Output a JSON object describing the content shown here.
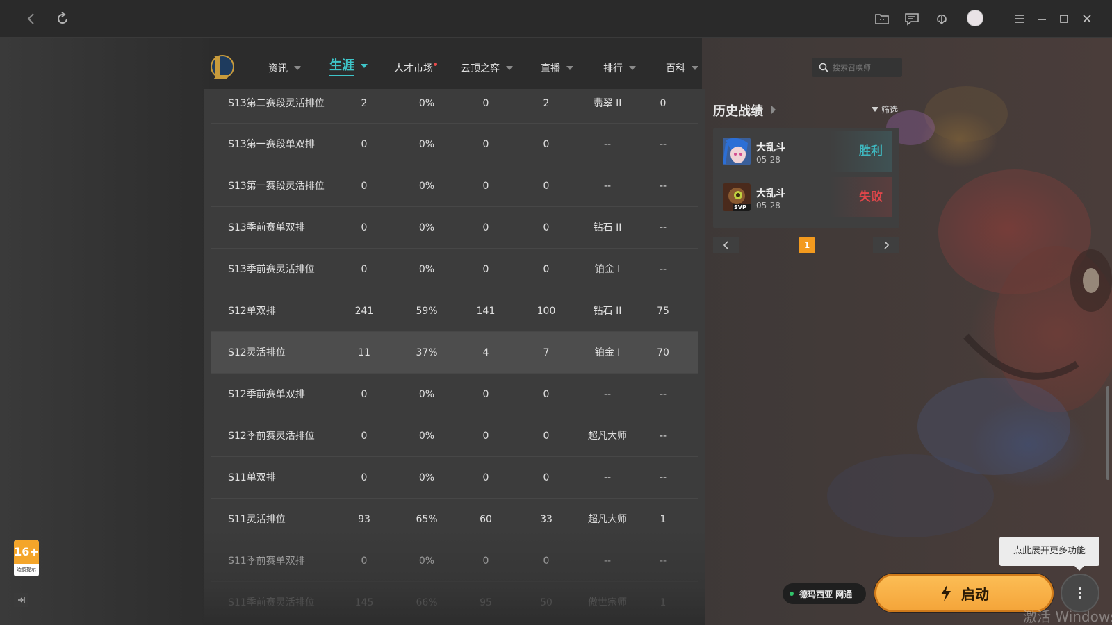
{
  "nav": {
    "items": [
      {
        "label": "资讯"
      },
      {
        "label": "生涯"
      },
      {
        "label": "人才市场"
      },
      {
        "label": "云顶之弈"
      },
      {
        "label": "直播"
      },
      {
        "label": "排行"
      },
      {
        "label": "百科"
      }
    ],
    "search_placeholder": "搜索召唤师"
  },
  "table": {
    "rows": [
      {
        "season": "S13第二赛段灵活排位",
        "games": "2",
        "winrate": "0%",
        "wins": "0",
        "losses": "2",
        "tier": "翡翠 II",
        "lp": "0"
      },
      {
        "season": "S13第一赛段单双排",
        "games": "0",
        "winrate": "0%",
        "wins": "0",
        "losses": "0",
        "tier": "--",
        "lp": "--"
      },
      {
        "season": "S13第一赛段灵活排位",
        "games": "0",
        "winrate": "0%",
        "wins": "0",
        "losses": "0",
        "tier": "--",
        "lp": "--"
      },
      {
        "season": "S13季前赛单双排",
        "games": "0",
        "winrate": "0%",
        "wins": "0",
        "losses": "0",
        "tier": "钻石 II",
        "lp": "--"
      },
      {
        "season": "S13季前赛灵活排位",
        "games": "0",
        "winrate": "0%",
        "wins": "0",
        "losses": "0",
        "tier": "铂金 I",
        "lp": "--"
      },
      {
        "season": "S12单双排",
        "games": "241",
        "winrate": "59%",
        "wins": "141",
        "losses": "100",
        "tier": "钻石 II",
        "lp": "75"
      },
      {
        "season": "S12灵活排位",
        "games": "11",
        "winrate": "37%",
        "wins": "4",
        "losses": "7",
        "tier": "铂金 I",
        "lp": "70"
      },
      {
        "season": "S12季前赛单双排",
        "games": "0",
        "winrate": "0%",
        "wins": "0",
        "losses": "0",
        "tier": "--",
        "lp": "--"
      },
      {
        "season": "S12季前赛灵活排位",
        "games": "0",
        "winrate": "0%",
        "wins": "0",
        "losses": "0",
        "tier": "超凡大师",
        "lp": "--"
      },
      {
        "season": "S11单双排",
        "games": "0",
        "winrate": "0%",
        "wins": "0",
        "losses": "0",
        "tier": "--",
        "lp": "--"
      },
      {
        "season": "S11灵活排位",
        "games": "93",
        "winrate": "65%",
        "wins": "60",
        "losses": "33",
        "tier": "超凡大师",
        "lp": "1"
      },
      {
        "season": "S11季前赛单双排",
        "games": "0",
        "winrate": "0%",
        "wins": "0",
        "losses": "0",
        "tier": "--",
        "lp": "--"
      },
      {
        "season": "S11季前赛灵活排位",
        "games": "145",
        "winrate": "66%",
        "wins": "95",
        "losses": "50",
        "tier": "傲世宗师",
        "lp": "1"
      }
    ]
  },
  "history": {
    "title": "历史战绩",
    "filter_label": "筛选",
    "matches": [
      {
        "mode": "大乱斗",
        "date": "05-28",
        "result": "胜利"
      },
      {
        "mode": "大乱斗",
        "date": "05-28",
        "result": "失败"
      }
    ],
    "page": "1",
    "svp_label": "SVP"
  },
  "bottom": {
    "tooltip": "点此展开更多功能",
    "server": "德玛西亚 网通",
    "launch_label": "启动",
    "watermark": "激活 Windows",
    "age_rating": "16+",
    "age_caption": "适龄提示"
  },
  "colors": {
    "accent": "#3ec5c9",
    "win": "#3fb7bf",
    "lose": "#e0464a",
    "launch": "#f4a53a",
    "page_active": "#f39a1e"
  }
}
